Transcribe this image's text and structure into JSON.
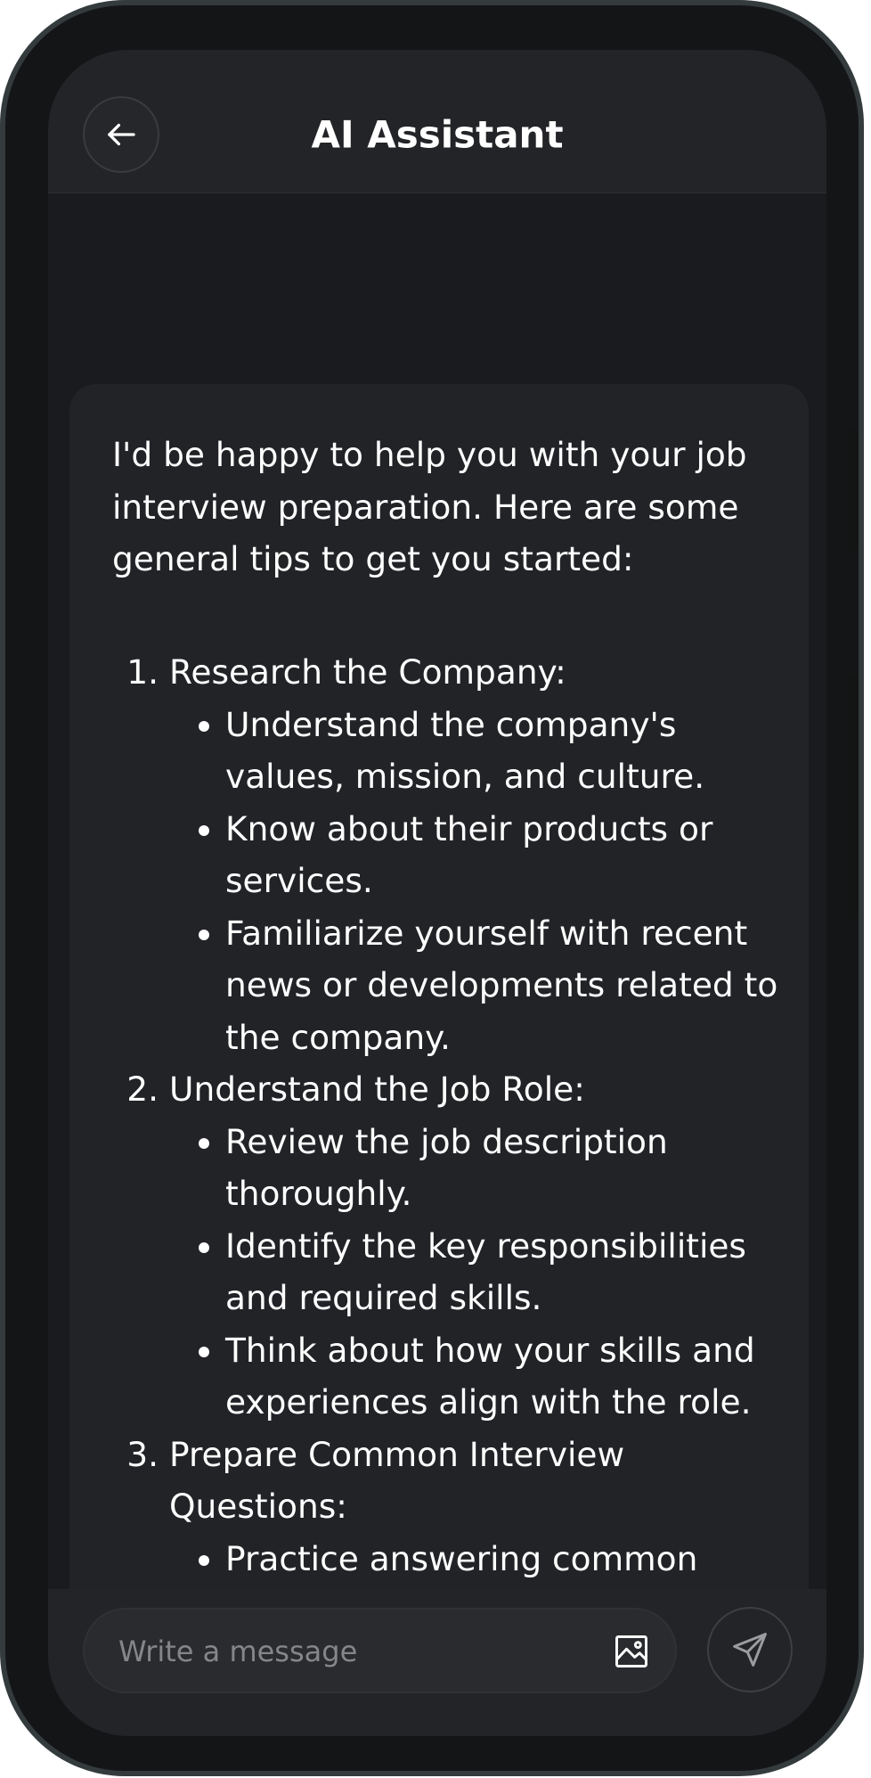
{
  "header": {
    "title": "AI Assistant",
    "back_icon": "arrow-left-icon"
  },
  "message": {
    "intro": "I'd be happy to help you with your job interview preparation. Here are some general tips to get you started:",
    "sections": [
      {
        "heading": "Research the Company:",
        "points": [
          "Understand the company's values, mission, and culture.",
          "Know about their products or services.",
          "Familiarize yourself with recent news or developments related to the company."
        ]
      },
      {
        "heading": "Understand the Job Role:",
        "points": [
          "Review the job description thoroughly.",
          "Identify the key responsibilities and required skills.",
          "Think about how your skills and experiences align with the role."
        ]
      },
      {
        "heading": "Prepare Common Interview Questions:",
        "points": [
          "Practice answering common"
        ]
      }
    ]
  },
  "composer": {
    "placeholder": "Write a message",
    "image_icon": "image-icon",
    "send_icon": "send-icon"
  },
  "colors": {
    "background": "#1a1b1e",
    "surface": "#232427",
    "bubble": "#222327",
    "text": "#ffffff",
    "placeholder": "#85868a",
    "frame": "#343b3d"
  }
}
